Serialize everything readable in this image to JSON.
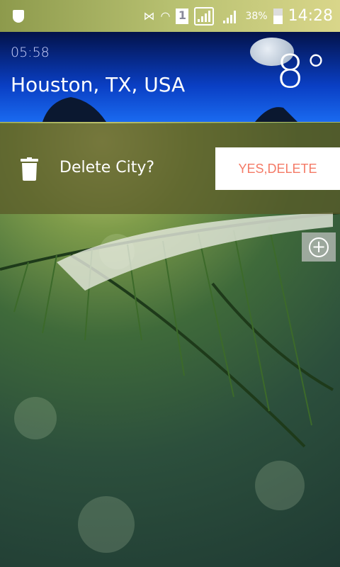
{
  "status_bar": {
    "battery_percent": "38%",
    "time": "14:28",
    "icons": [
      "shield-icon",
      "vibrate-off-icon",
      "wifi-icon",
      "sim-1-icon",
      "signal-icon",
      "signal-icon",
      "battery-icon"
    ]
  },
  "city_card": {
    "local_time": "05:58",
    "city": "Houston, TX, USA",
    "temperature": "8°"
  },
  "delete_prompt": {
    "label": "Delete City?",
    "confirm_label": "YES,DELETE",
    "confirm_color": "#f47a66"
  },
  "add_button": {
    "icon": "add-circle-icon",
    "label": "+"
  }
}
